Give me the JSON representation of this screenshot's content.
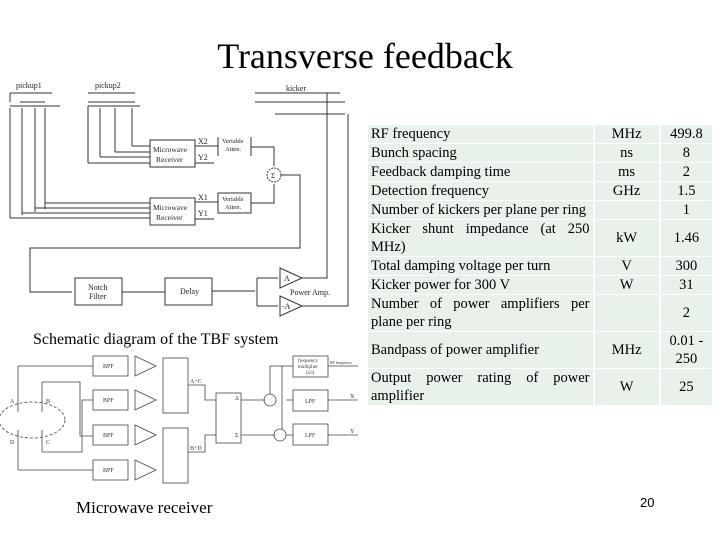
{
  "slide": {
    "title": "Transverse feedback",
    "page_number": "20"
  },
  "schematic": {
    "caption": "Schematic diagram of the TBF system",
    "labels": {
      "pickup1": "pickup1",
      "pickup2": "pickup2",
      "kicker": "kicker",
      "receiver_line1": "Microwave",
      "receiver_line2": "Receiver",
      "x2": "X2",
      "y2": "Y2",
      "x1": "X1",
      "y1": "Y1",
      "atten_line1": "Veriable",
      "atten_line2": "Atten.",
      "sum": "Σ",
      "notch_line1": "Notch",
      "notch_line2": "Filter",
      "delay": "Delay",
      "amp_pos": "A",
      "amp_neg": "-A",
      "power_amp": "Power Amp."
    }
  },
  "receiver": {
    "caption": "Microwave receiver",
    "labels": {
      "a": "A",
      "b": "B",
      "c": "C",
      "d": "D",
      "bpf": "BPF",
      "lpf": "LPF",
      "apc": "A+C",
      "bpd": "B+D",
      "delta": "Δ",
      "sigma": "Σ",
      "freq_mult_line1": "frequency",
      "freq_mult_line2": "multiplier",
      "freq_mult_line3": "(x3)",
      "rf_frequency": "RF frequency",
      "x_out": "X",
      "y_out": "Y"
    }
  },
  "table": {
    "rows": [
      {
        "name": "RF frequency",
        "unit": "MHz",
        "value": "499.8"
      },
      {
        "name": "Bunch spacing",
        "unit": "ns",
        "value": "8"
      },
      {
        "name": "Feedback damping time",
        "unit": "ms",
        "value": "2"
      },
      {
        "name": "Detection frequency",
        "unit": "GHz",
        "value": "1.5"
      },
      {
        "name": "Number of kickers per plane per ring",
        "unit": "",
        "value": "1"
      },
      {
        "name": "Kicker shunt impedance (at 250 MHz)",
        "unit": "kW",
        "value": "1.46"
      },
      {
        "name": "Total damping voltage per turn",
        "unit": "V",
        "value": "300"
      },
      {
        "name": "Kicker power for 300 V",
        "unit": "W",
        "value": "31"
      },
      {
        "name": "Number of power amplifiers per plane per ring",
        "unit": "",
        "value": "2"
      },
      {
        "name": "Bandpass of power amplifier",
        "unit": "MHz",
        "value": "0.01 - 250"
      },
      {
        "name": "Output power rating of power amplifier",
        "unit": "W",
        "value": "25"
      }
    ]
  }
}
